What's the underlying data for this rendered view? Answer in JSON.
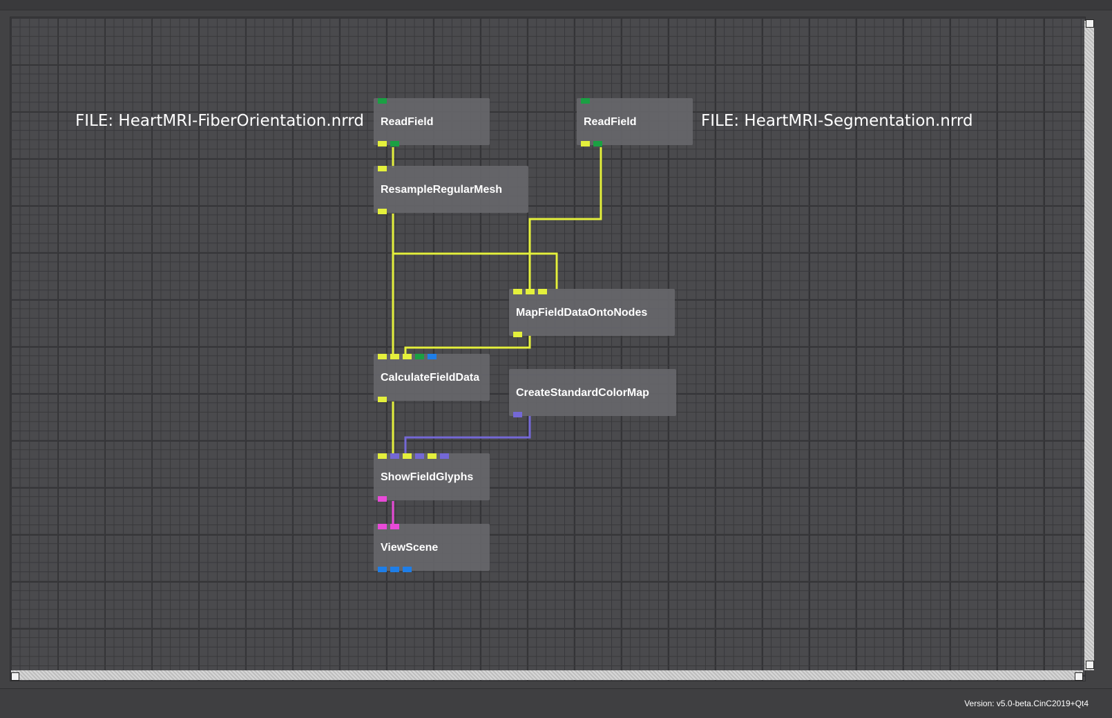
{
  "notes": {
    "left": "FILE: HeartMRI-FiberOrientation.nrrd",
    "right": "FILE: HeartMRI-Segmentation.nrrd"
  },
  "modules": {
    "readfield_1": {
      "title": "ReadField"
    },
    "readfield_2": {
      "title": "ReadField"
    },
    "resample": {
      "title": "ResampleRegularMesh"
    },
    "mapfield": {
      "title": "MapFieldDataOntoNodes"
    },
    "calculate": {
      "title": "CalculateFieldData"
    },
    "colormap": {
      "title": "CreateStandardColorMap"
    },
    "glyphs": {
      "title": "ShowFieldGlyphs"
    },
    "viewscene": {
      "title": "ViewScene"
    }
  },
  "port_colors": {
    "field": "#e4f03c",
    "string": "#1aa043",
    "matrix": "#1e7ee8",
    "colormap": "#7468d6",
    "geometry": "#e94ad8"
  },
  "status": {
    "version": "Version: v5.0-beta.CinC2019+Qt4"
  }
}
